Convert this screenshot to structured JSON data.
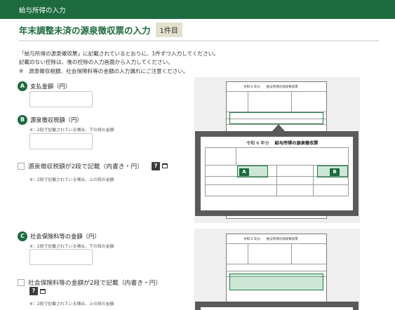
{
  "header": {
    "title": "給与所得の入力"
  },
  "page": {
    "title": "年末調整未済の源泉徴収票の入力",
    "count_badge": "1件目"
  },
  "intro": {
    "line1": "「給与所得の源泉徴収票」に記載されているとおりに、1件ずつ入力してください。",
    "line2": "記載のない控除は、後の控除の入力画面から入力してください。",
    "line3": "※　源泉徴収税額、社会保険料等の金額の入力漏れにご注意ください。"
  },
  "fields": {
    "payment": {
      "marker": "A",
      "label": "支払金額（円）",
      "value": ""
    },
    "withholding": {
      "marker": "B",
      "label": "源泉徴収税額（円）",
      "note": "※：2段で記載されている場合、下の段の金額",
      "value": ""
    },
    "withholding_two_rows": {
      "label": "源泉徴収税額が2段で記載（内書き・円）",
      "note": "※：2段で記載されている場合、上の段の金額",
      "help": "?"
    },
    "social_insurance": {
      "marker": "C",
      "label": "社会保険料等の金額（円）",
      "note": "※：2段で記載されている場合、下の段の金額",
      "value": ""
    },
    "social_insurance_two_rows": {
      "label": "社会保険料等の金額が2段で記載（内書き・円）",
      "note": "※：2段で記載されている場合、上の段の金額",
      "help": "?"
    }
  },
  "illustration": {
    "mini_form_title": "令和 6 年分　　給与所得の源泉徴収票",
    "zoom_year": "令和 6 年分",
    "zoom_form_title": "給与所得の源泉徴収票",
    "marker_a": "A",
    "marker_b": "B"
  },
  "colors": {
    "header_green": "#1d6b3f",
    "title_green": "#1e6a3c",
    "badge_bg": "#e3e0cc",
    "highlight_green": "#1f7a44"
  }
}
